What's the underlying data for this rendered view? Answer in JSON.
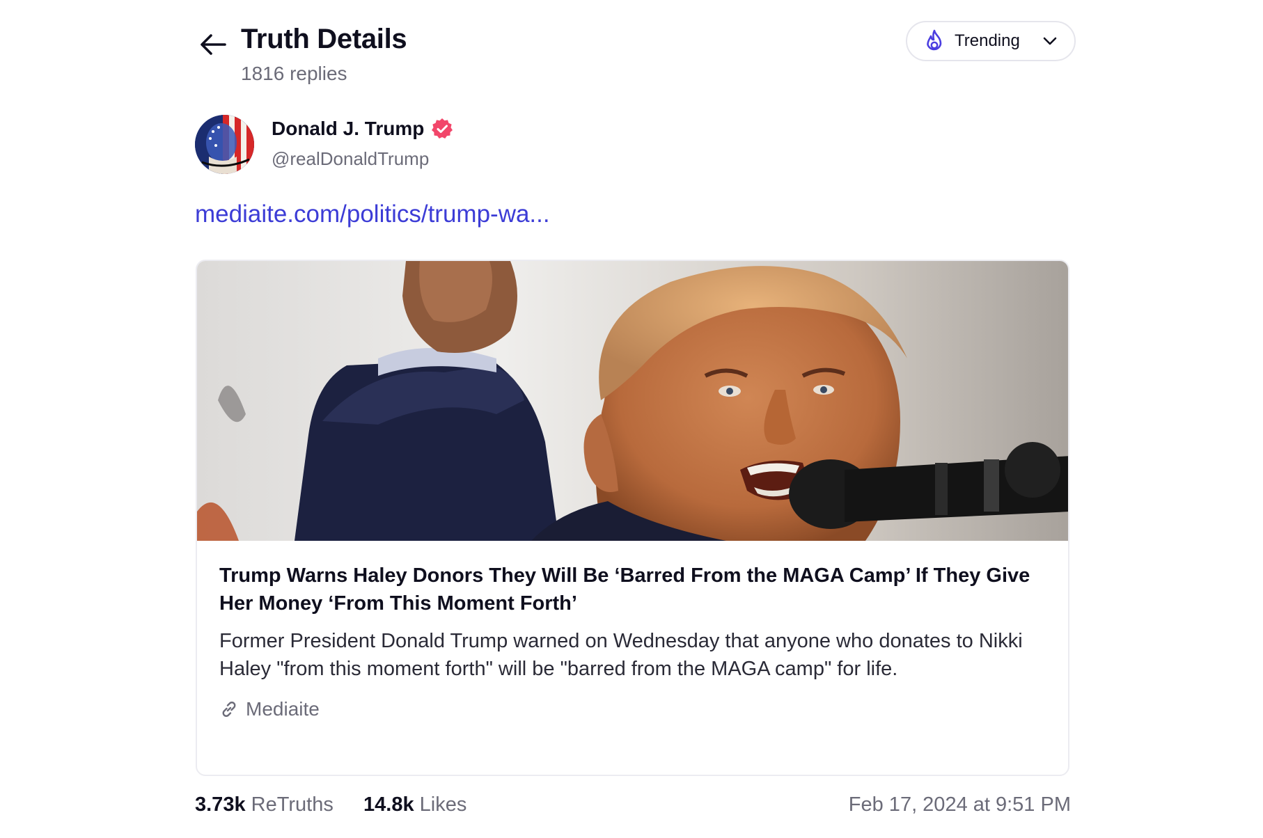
{
  "header": {
    "title": "Truth Details",
    "replies": "1816 replies",
    "sort": {
      "label": "Trending"
    }
  },
  "author": {
    "name": "Donald J. Trump",
    "handle": "@realDonaldTrump",
    "verified": true
  },
  "post": {
    "link_text": "mediaite.com/politics/trump-wa..."
  },
  "card": {
    "title": "Trump Warns Haley Donors They Will Be ‘Barred From the MAGA Camp’ If They Give Her Money ‘From This Moment Forth’",
    "description": "Former President Donald Trump warned on Wednesday that anyone who donates to Nikki Haley \"from this moment forth\" will be \"barred from the MAGA camp\" for life.",
    "source": "Mediaite"
  },
  "stats": {
    "retruths_count": "3.73k",
    "retruths_label": "ReTruths",
    "likes_count": "14.8k",
    "likes_label": "Likes",
    "timestamp": "Feb 17, 2024 at 9:51 PM"
  },
  "colors": {
    "accent": "#3c3cd6",
    "verified": "#f2466a",
    "muted": "#6b6b78",
    "border": "#ececf1"
  },
  "icons": {
    "back": "arrow-left-icon",
    "trending": "flame-icon",
    "dropdown": "chevron-down-icon",
    "verified": "verified-badge-icon",
    "source": "link-icon"
  }
}
